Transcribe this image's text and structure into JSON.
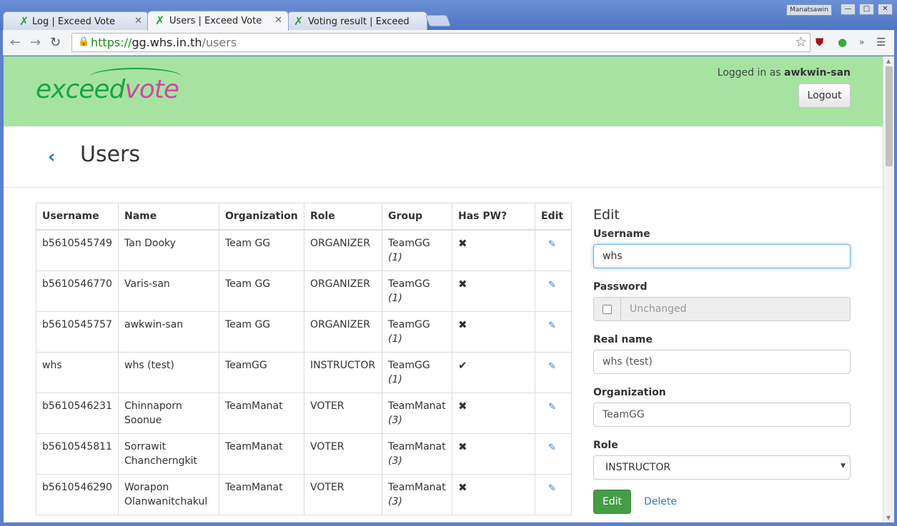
{
  "browser": {
    "tabs": [
      {
        "label": "Log | Exceed Vote",
        "active": false
      },
      {
        "label": "Users | Exceed Vote",
        "active": true
      },
      {
        "label": "Voting result | Exceed",
        "active": false
      }
    ],
    "window_user": "Manatsawin",
    "url_scheme": "https://",
    "url_host": "gg.whs.in.th",
    "url_path": "/users"
  },
  "header": {
    "logo_part1": "exceed",
    "logo_part2": "vote",
    "logged_in_prefix": "Logged in as ",
    "username": "awkwin-san",
    "logout_label": "Logout",
    "colors": {
      "header_bg": "#a6e3a1",
      "logo_green": "#1aa34a",
      "logo_pink": "#cc4aa8"
    }
  },
  "page": {
    "title": "Users"
  },
  "table": {
    "headers": [
      "Username",
      "Name",
      "Organization",
      "Role",
      "Group",
      "Has PW?",
      "Edit"
    ],
    "rows": [
      {
        "username": "b5610545749",
        "name": "Tan Dooky",
        "org": "Team GG",
        "role": "ORGANIZER",
        "group": "TeamGG",
        "group_count": "(1)",
        "has_pw": "✖"
      },
      {
        "username": "b5610546770",
        "name": "Varis-san",
        "org": "Team GG",
        "role": "ORGANIZER",
        "group": "TeamGG",
        "group_count": "(1)",
        "has_pw": "✖"
      },
      {
        "username": "b5610545757",
        "name": "awkwin-san",
        "org": "Team GG",
        "role": "ORGANIZER",
        "group": "TeamGG",
        "group_count": "(1)",
        "has_pw": "✖"
      },
      {
        "username": "whs",
        "name": "whs (test)",
        "org": "TeamGG",
        "role": "INSTRUCTOR",
        "group": "TeamGG",
        "group_count": "(1)",
        "has_pw": "✔"
      },
      {
        "username": "b5610546231",
        "name": "Chinnaporn Soonue",
        "org": "TeamManat",
        "role": "VOTER",
        "group": "TeamManat",
        "group_count": "(3)",
        "has_pw": "✖"
      },
      {
        "username": "b5610545811",
        "name": "Sorrawit Chancherngkit",
        "org": "TeamManat",
        "role": "VOTER",
        "group": "TeamManat",
        "group_count": "(3)",
        "has_pw": "✖"
      },
      {
        "username": "b5610546290",
        "name": "Worapon Olanwanitchakul",
        "org": "TeamManat",
        "role": "VOTER",
        "group": "TeamManat",
        "group_count": "(3)",
        "has_pw": "✖"
      }
    ]
  },
  "edit_form": {
    "heading": "Edit",
    "username_label": "Username",
    "username_value": "whs",
    "password_label": "Password",
    "password_placeholder": "Unchanged",
    "realname_label": "Real name",
    "realname_value": "whs (test)",
    "org_label": "Organization",
    "org_value": "TeamGG",
    "role_label": "Role",
    "role_value": "INSTRUCTOR",
    "edit_button": "Edit",
    "delete_link": "Delete"
  }
}
